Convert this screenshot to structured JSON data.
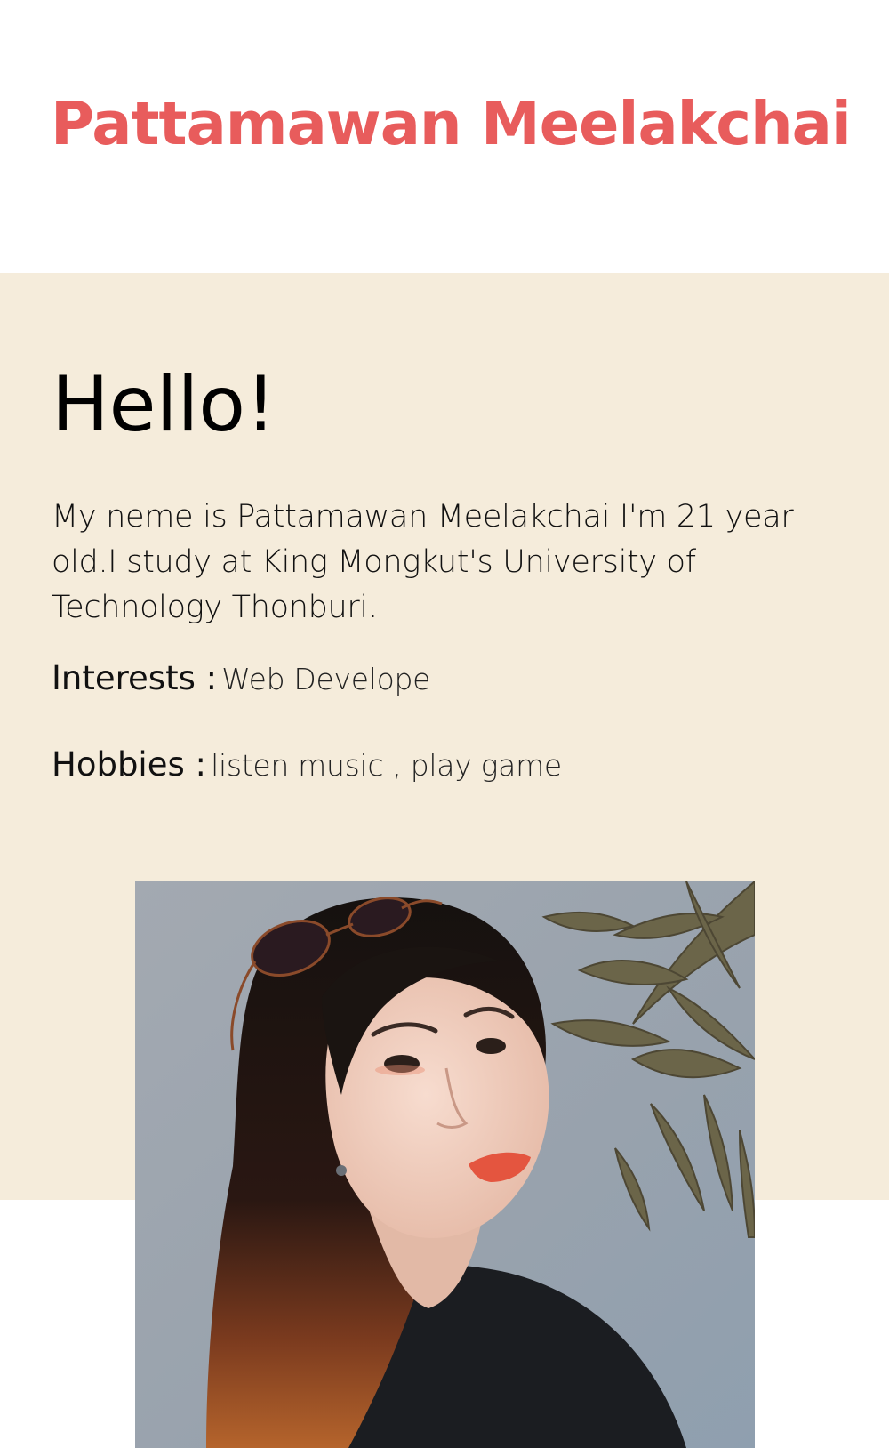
{
  "header": {
    "site_title": "Pattamawan Meelakchai"
  },
  "about": {
    "heading": "Hello!",
    "bio": "My neme is Pattamawan Meelakchai I'm 21 year old.I study at King Mongkut's University of Technology Thonburi.",
    "interests_label": "Interests :",
    "interests_value": "Web Develope",
    "hobbies_label": "Hobbies :",
    "hobbies_value": "listen music , play game"
  },
  "photo": {
    "subject": "portrait of a woman with sunglasses on her head beside dried eucalyptus leaves"
  },
  "colors": {
    "title": "#e85c5c",
    "about_background": "#f5ecdb",
    "photo_background": "#97a3ae"
  }
}
